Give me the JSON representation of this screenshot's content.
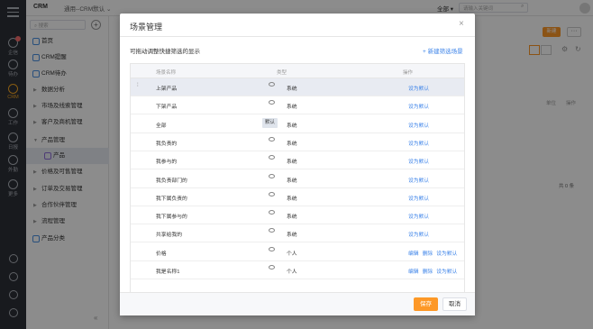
{
  "colors": {
    "accent": "#fd9827",
    "link": "#3e84e9",
    "rail_bg": "#2d3037"
  },
  "topbar": {
    "brand": "CRM",
    "app_selector": "通用--CRM默认",
    "scope": "全部",
    "search_placeholder": "请输入关键词"
  },
  "rail": [
    {
      "label": "企信",
      "icon": "chat-icon"
    },
    {
      "label": "待办",
      "icon": "todo-icon"
    },
    {
      "label": "CRM",
      "icon": "crm-icon",
      "active": true
    },
    {
      "label": "工作",
      "icon": "briefcase-icon"
    },
    {
      "label": "日报",
      "icon": "report-icon"
    },
    {
      "label": "外勤",
      "icon": "location-icon"
    },
    {
      "label": "更多",
      "icon": "grid-icon"
    }
  ],
  "sidebar": {
    "search_placeholder": "搜索",
    "add_label": "+",
    "items": [
      {
        "label": "首页"
      },
      {
        "label": "CRM提醒"
      },
      {
        "label": "CRM待办"
      },
      {
        "label": "数据分析"
      },
      {
        "label": "市场及线索管理"
      },
      {
        "label": "客户及商机管理"
      },
      {
        "label": "产品管理"
      },
      {
        "label": "产品"
      },
      {
        "label": "价格及可售管理"
      },
      {
        "label": "订单及交易管理"
      },
      {
        "label": "合作伙伴管理"
      },
      {
        "label": "流程管理"
      },
      {
        "label": "产品分类"
      }
    ],
    "collapse_icon": "«"
  },
  "background": {
    "new_button": "新建",
    "more_button": "···",
    "col_unit": "单位",
    "col_ops": "操作",
    "total": "共 0 条"
  },
  "modal": {
    "title": "场景管理",
    "close_icon": "×",
    "hint": "可拖动调整快捷筛选的显示",
    "new_scene": "+ 新建筛选场景",
    "columns": {
      "name": "场景名称",
      "type": "类型",
      "ops": "操作"
    },
    "rows": [
      {
        "name": "上架产品",
        "type": "系统",
        "ops": [
          "设为默认"
        ],
        "highlight": true
      },
      {
        "name": "下架产品",
        "type": "系统",
        "ops": [
          "设为默认"
        ]
      },
      {
        "name": "全部",
        "type": "系统",
        "ops": [
          "设为默认"
        ],
        "default_tag": "默认"
      },
      {
        "name": "我负责的",
        "type": "系统",
        "ops": [
          "设为默认"
        ]
      },
      {
        "name": "我参与的",
        "type": "系统",
        "ops": [
          "设为默认"
        ]
      },
      {
        "name": "我负责部门的",
        "type": "系统",
        "ops": [
          "设为默认"
        ]
      },
      {
        "name": "我下属负责的",
        "type": "系统",
        "ops": [
          "设为默认"
        ]
      },
      {
        "name": "我下属参与的",
        "type": "系统",
        "ops": [
          "设为默认"
        ]
      },
      {
        "name": "共享给我的",
        "type": "系统",
        "ops": [
          "设为默认"
        ]
      },
      {
        "name": "价格",
        "type": "个人",
        "ops": [
          "编辑",
          "删除",
          "设为默认"
        ]
      },
      {
        "name": "我是名称1",
        "type": "个人",
        "ops": [
          "编辑",
          "删除",
          "设为默认"
        ]
      }
    ],
    "save_label": "保存",
    "cancel_label": "取消"
  }
}
